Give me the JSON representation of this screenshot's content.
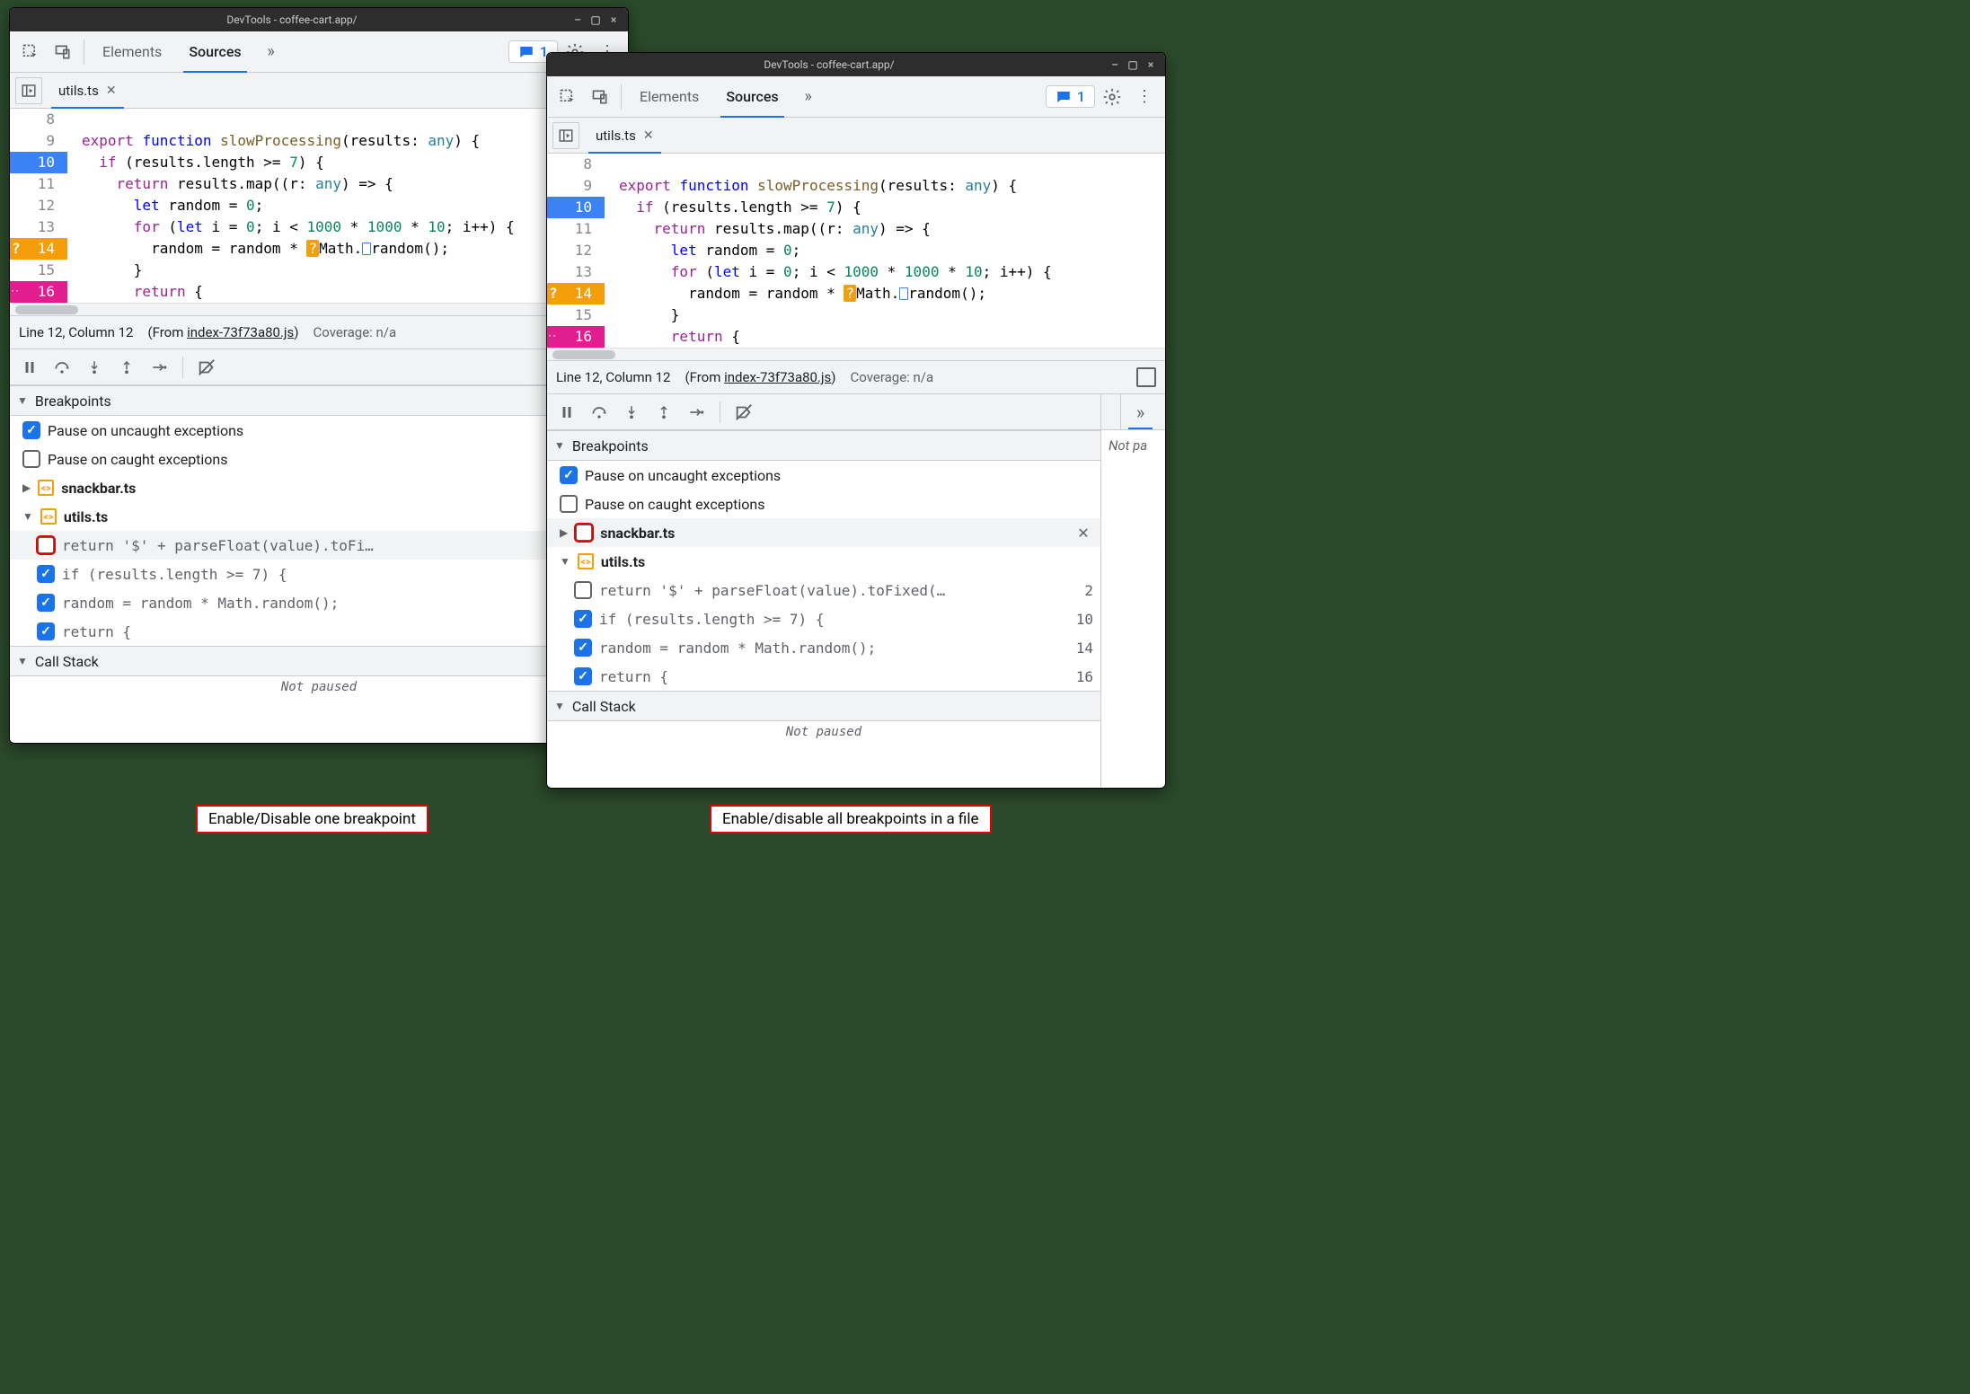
{
  "title": "DevTools - coffee-cart.app/",
  "toolbar": {
    "tab_elements": "Elements",
    "tab_sources": "Sources",
    "issues_count": "1"
  },
  "file_tab": {
    "name": "utils.ts"
  },
  "code_lines": [
    {
      "n": 8,
      "cls": "",
      "html": ""
    },
    {
      "n": 9,
      "cls": "",
      "html": "<span class='tok-kw'>export</span> <span class='tok-kw2'>function</span> <span class='tok-fn'>slowProcessing</span>(<span>results</span>: <span class='tok-type'>any</span>) {"
    },
    {
      "n": 10,
      "cls": "bp-blue",
      "html": "  <span class='tok-kw'>if</span> (results.length &gt;= <span class='tok-num'>7</span>) {"
    },
    {
      "n": 11,
      "cls": "",
      "html": "    <span class='tok-kw'>return</span> results.map((r: <span class='tok-type'>any</span>) =&gt; {"
    },
    {
      "n": 12,
      "cls": "",
      "html": "      <span class='tok-kw2'>let</span> random = <span class='tok-num'>0</span>;"
    },
    {
      "n": 13,
      "cls": "",
      "html": "      <span class='tok-kw'>for</span> (<span class='tok-kw2'>let</span> i = <span class='tok-num'>0</span>; i &lt; <span class='tok-num'>1000</span> * <span class='tok-num'>1000</span> * <span class='tok-num'>10</span>; i++) {"
    },
    {
      "n": 14,
      "cls": "bp-orange",
      "html": "        random = random * <span class='ih-orange'>?</span>Math.<span class='ih-blue'></span>random();",
      "q": "?"
    },
    {
      "n": 15,
      "cls": "",
      "html": "      }"
    },
    {
      "n": 16,
      "cls": "bp-pink",
      "html": "      <span class='tok-kw'>return</span> {",
      "dots": "··"
    }
  ],
  "status": {
    "pos": "Line 12, Column 12",
    "from_label": "(From ",
    "from_file": "index-73f73a80.js",
    "from_close": ")",
    "coverage": "Coverage: n/a"
  },
  "breakpointsSection": {
    "title": "Breakpoints",
    "pause_uncaught": "Pause on uncaught exceptions",
    "pause_caught": "Pause on caught exceptions",
    "file_snackbar": "snackbar.ts",
    "file_utils": "utils.ts",
    "bp1_code": "return '$' + parseFloat(value).toFi…",
    "bp1_code_long": "return '$' + parseFloat(value).toFixed(…",
    "bp1_line": "2",
    "bp2_code": "if (results.length >= 7) {",
    "bp2_line": "10",
    "bp3_code": "random = random * Math.random();",
    "bp3_line": "14",
    "bp4_code": "return {",
    "bp4_line": "16"
  },
  "callstack_title": "Call Stack",
  "not_paused": "Not paused",
  "side_text": "Not pa",
  "caption_a": "Enable/Disable one breakpoint",
  "caption_b": "Enable/disable all breakpoints in a file"
}
